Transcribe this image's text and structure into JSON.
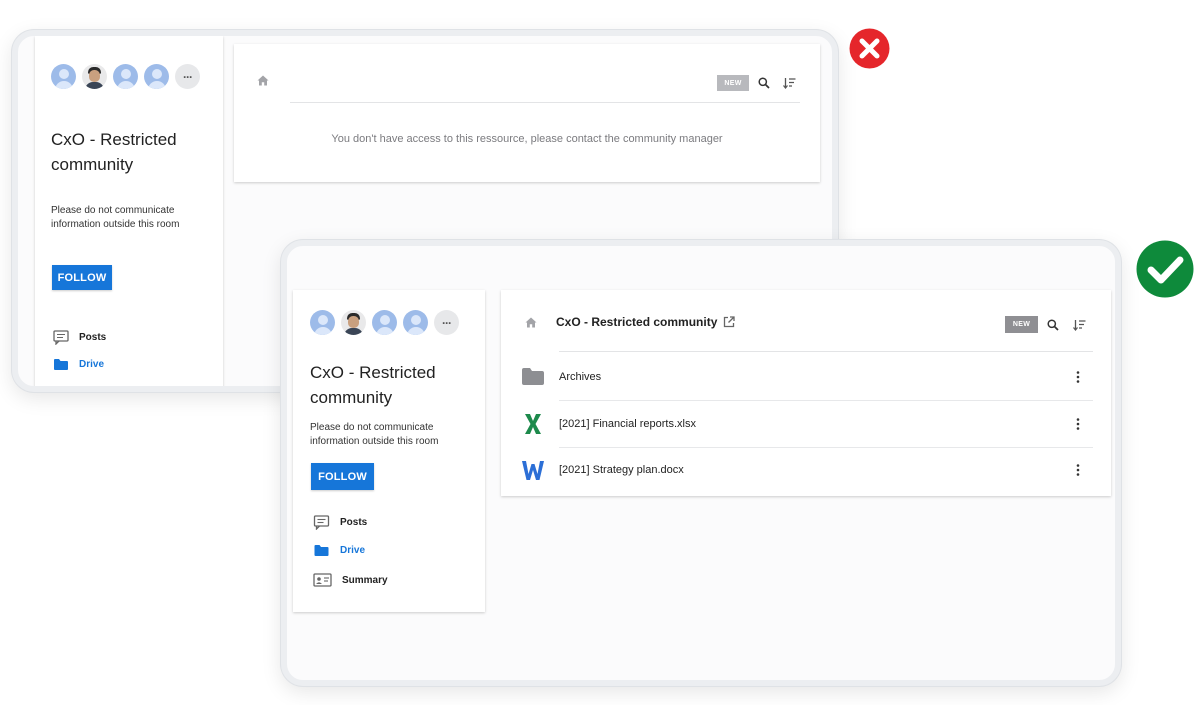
{
  "denied_view": {
    "avatars": [
      "user-avatar",
      "user-photo",
      "user-avatar",
      "user-avatar"
    ],
    "more_label": "···",
    "title_line1": "CxO - Restricted",
    "title_line2": "community",
    "description_line1": "Please do not communicate",
    "description_line2": "information outside this room",
    "follow_label": "FOLLOW",
    "nav": [
      {
        "label": "Posts",
        "icon": "posts-icon"
      },
      {
        "label": "Drive",
        "icon": "folder-icon",
        "active": true
      }
    ],
    "new_label": "NEW",
    "message": "You don't have access to this ressource, please contact the community manager",
    "status": "denied"
  },
  "granted_view": {
    "avatars": [
      "user-avatar",
      "user-photo",
      "user-avatar",
      "user-avatar"
    ],
    "more_label": "···",
    "title_line1": "CxO - Restricted",
    "title_line2": "community",
    "description_line1": "Please do not communicate",
    "description_line2": "information outside this room",
    "follow_label": "FOLLOW",
    "nav": [
      {
        "label": "Posts",
        "icon": "posts-icon"
      },
      {
        "label": "Drive",
        "icon": "folder-icon",
        "active": true
      },
      {
        "label": "Summary",
        "icon": "summary-icon"
      }
    ],
    "drive_title": "CxO - Restricted community",
    "new_label": "NEW",
    "files": [
      {
        "name": "Archives",
        "type": "folder"
      },
      {
        "name": "[2021] Financial reports.xlsx",
        "type": "excel"
      },
      {
        "name": "[2021] Strategy plan.docx",
        "type": "word"
      }
    ],
    "status": "granted"
  },
  "colors": {
    "accent": "#1676d9",
    "denied": "#e5262b",
    "granted": "#0e8a3b",
    "excel": "#1d8a4c",
    "word": "#2c6fd6"
  }
}
